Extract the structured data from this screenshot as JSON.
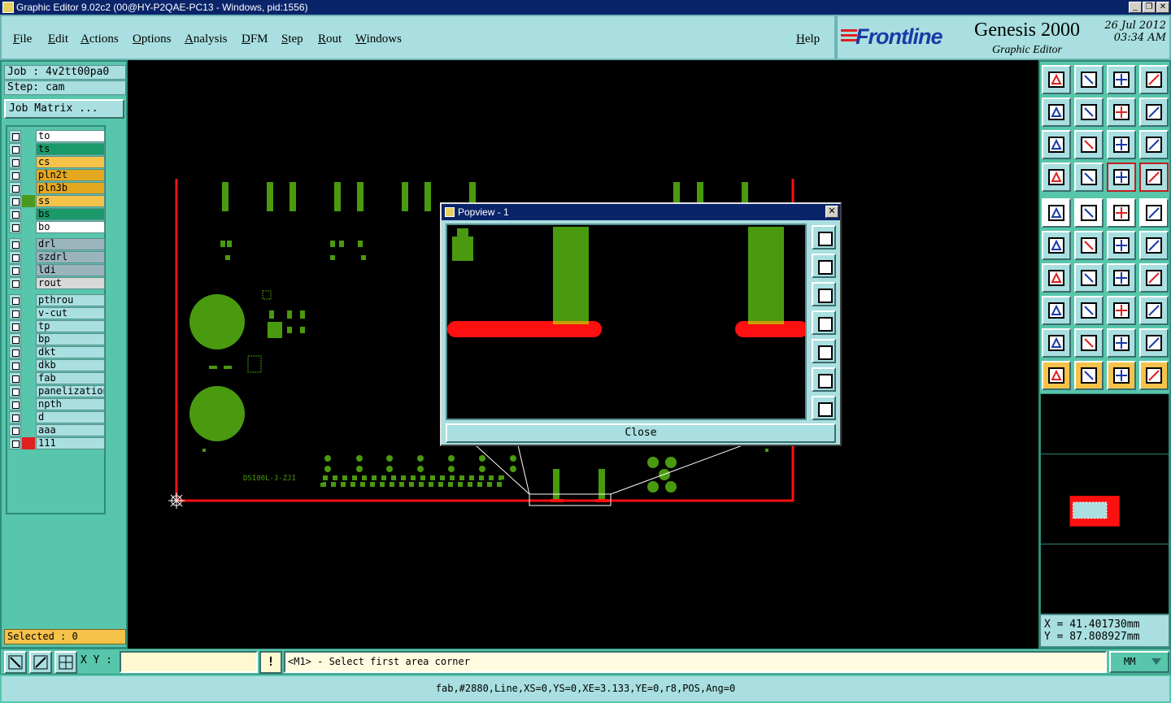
{
  "window": {
    "title": "Graphic Editor 9.02c2 (00@HY-P2QAE-PC13 - Windows, pid:1556)",
    "min_label": "_",
    "max_label": "❐",
    "close_label": "✕"
  },
  "menu": {
    "items": [
      "File",
      "Edit",
      "Actions",
      "Options",
      "Analysis",
      "DFM",
      "Step",
      "Rout",
      "Windows"
    ],
    "help": "Help"
  },
  "brand": {
    "logo": "Frontline",
    "product": "Genesis 2000",
    "subtitle": "Graphic Editor",
    "date": "26 Jul 2012",
    "time": "03:34 AM"
  },
  "left": {
    "job": "Job : 4v2tt00pa0",
    "step": "Step: cam",
    "job_matrix": "Job Matrix ...",
    "selected": "Selected : 0",
    "layers": [
      {
        "name": "to",
        "color": "#ffffff",
        "mark": ""
      },
      {
        "name": "ts",
        "color": "#1a9a6a",
        "mark": ""
      },
      {
        "name": "cs",
        "color": "#f5c24a",
        "mark": ""
      },
      {
        "name": "pln2t",
        "color": "#e3a820",
        "mark": ""
      },
      {
        "name": "pln3b",
        "color": "#e3a820",
        "mark": ""
      },
      {
        "name": "ss",
        "color": "#f5c24a",
        "mark": "#4a9a20"
      },
      {
        "name": "bs",
        "color": "#1a9a6a",
        "mark": ""
      },
      {
        "name": "bo",
        "color": "#ffffff",
        "mark": ""
      },
      {
        "name": "drl",
        "color": "#9ab4bc",
        "mark": ""
      },
      {
        "name": "szdrl",
        "color": "#9ab4bc",
        "mark": ""
      },
      {
        "name": "ldi",
        "color": "#9ab4bc",
        "mark": ""
      },
      {
        "name": "rout",
        "color": "#d8d8d8",
        "mark": ""
      },
      {
        "name": "pthrou",
        "color": "#a9dfe0",
        "mark": ""
      },
      {
        "name": "v-cut",
        "color": "#a9dfe0",
        "mark": ""
      },
      {
        "name": "tp",
        "color": "#a9dfe0",
        "mark": ""
      },
      {
        "name": "bp",
        "color": "#a9dfe0",
        "mark": ""
      },
      {
        "name": "dkt",
        "color": "#a9dfe0",
        "mark": ""
      },
      {
        "name": "dkb",
        "color": "#a9dfe0",
        "mark": ""
      },
      {
        "name": "fab",
        "color": "#a9dfe0",
        "mark": ""
      },
      {
        "name": "panelization",
        "color": "#a9dfe0",
        "mark": ""
      },
      {
        "name": "npth",
        "color": "#a9dfe0",
        "mark": ""
      },
      {
        "name": "d",
        "color": "#a9dfe0",
        "mark": ""
      },
      {
        "name": "aaa",
        "color": "#a9dfe0",
        "mark": ""
      },
      {
        "name": "111",
        "color": "#a9dfe0",
        "mark": "#e02020"
      }
    ]
  },
  "canvas": {
    "silk_text": "DSI00L-J-ZJI"
  },
  "popview": {
    "title": "Popview - 1",
    "close_label": "Close",
    "close_x": "✕"
  },
  "coords": {
    "x": "X = 41.401730mm",
    "y": "Y = 87.808927mm"
  },
  "bottom": {
    "xy_label": "X Y :",
    "xy_value": "",
    "warn": "!",
    "prompt": "<M1> - Select first area corner",
    "units": "MM"
  },
  "status": {
    "text": "fab,#2880,Line,XS=0,YS=0,XE=3.133,YE=0,r8,POS,Ang=0"
  },
  "colors": {
    "panel": "#57c6aa",
    "light_panel": "#a9dfe0",
    "copper": "#4a9a10",
    "profile": "#ff1010",
    "titlebar": "#0a246a"
  }
}
